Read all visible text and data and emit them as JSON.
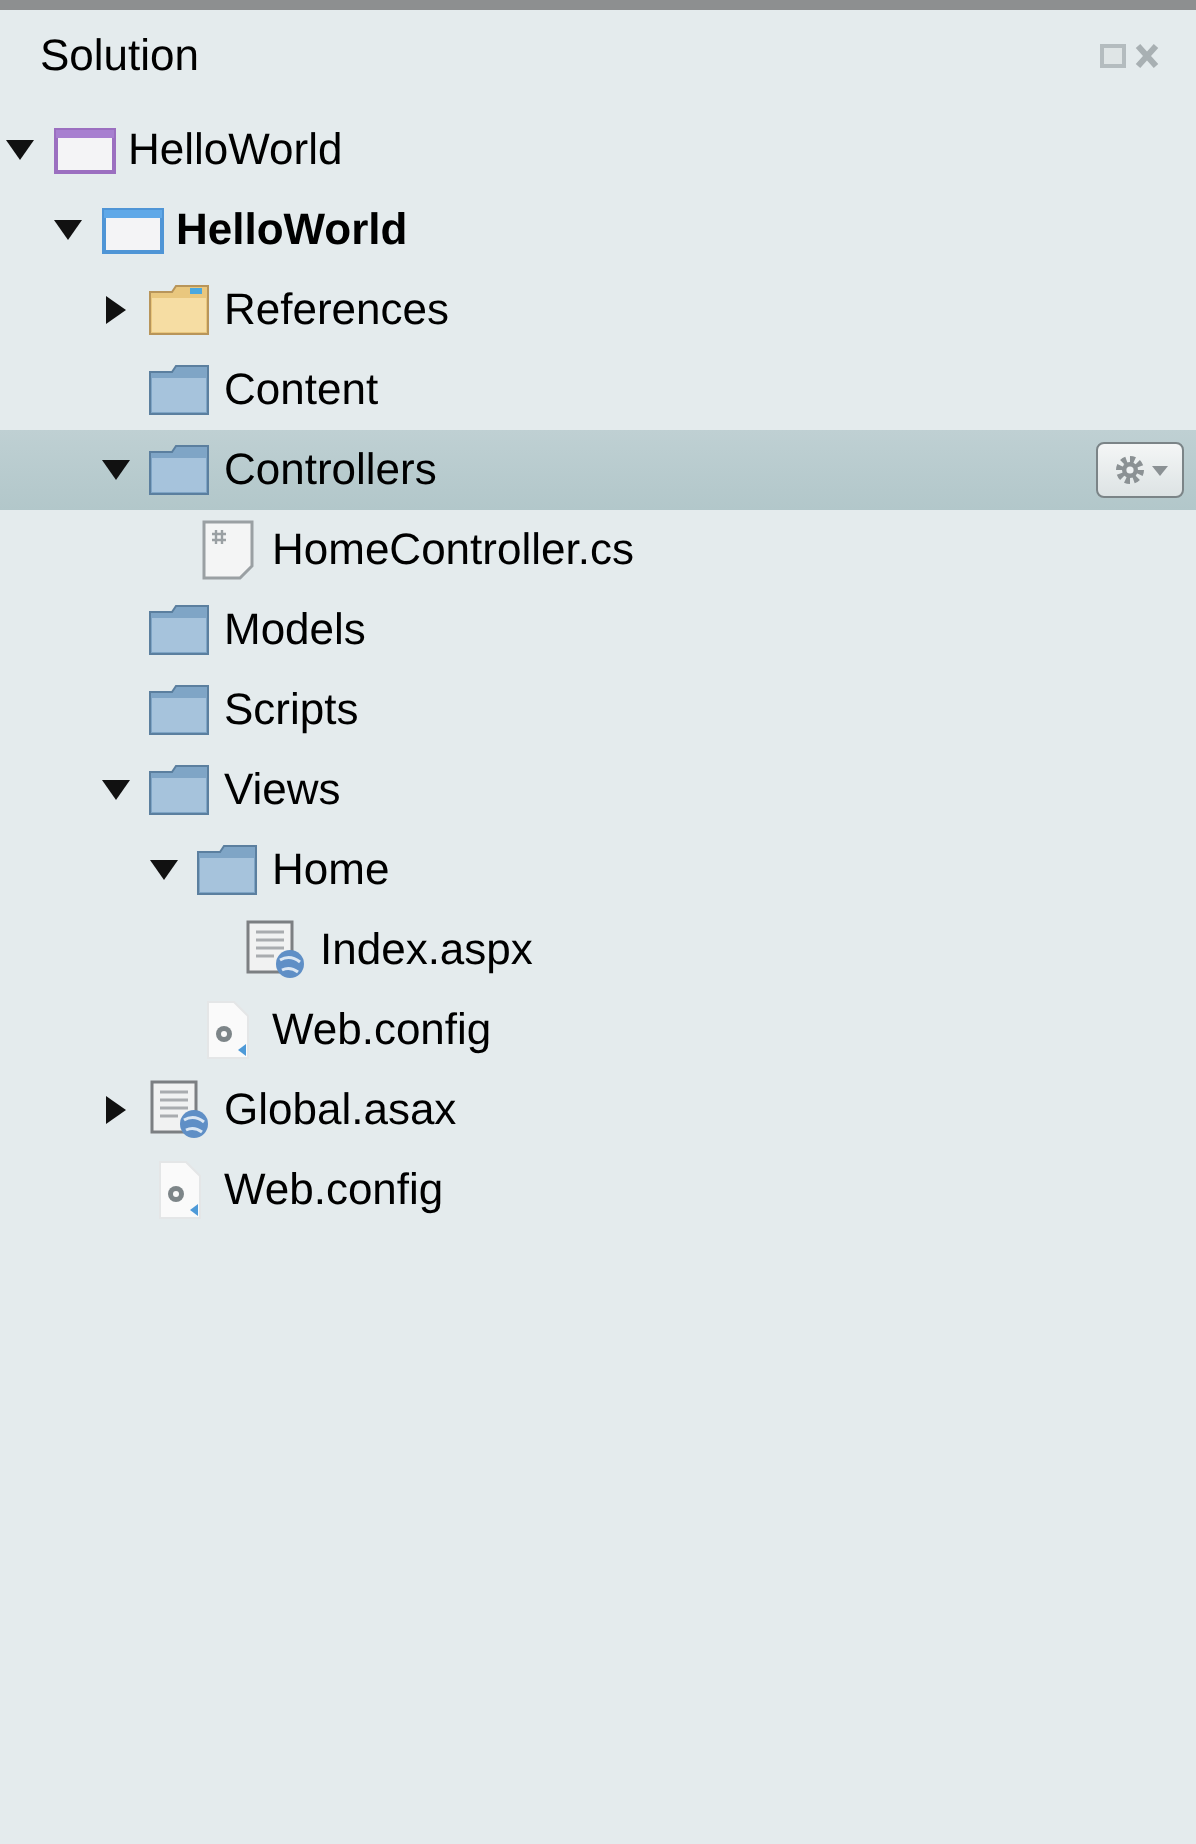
{
  "panel": {
    "title": "Solution"
  },
  "tree": [
    {
      "label": "HelloWorld",
      "kind": "solution",
      "expanded": true,
      "selected": false,
      "children": [
        {
          "label": "HelloWorld",
          "kind": "project",
          "startup": true,
          "expanded": true,
          "selected": false,
          "children": [
            {
              "label": "References",
              "kind": "references",
              "expanded": false,
              "selected": false
            },
            {
              "label": "Content",
              "kind": "folder",
              "selected": false
            },
            {
              "label": "Controllers",
              "kind": "folder",
              "expanded": true,
              "selected": true,
              "children": [
                {
                  "label": "HomeController.cs",
                  "kind": "cs",
                  "selected": false
                }
              ]
            },
            {
              "label": "Models",
              "kind": "folder",
              "selected": false
            },
            {
              "label": "Scripts",
              "kind": "folder",
              "selected": false
            },
            {
              "label": "Views",
              "kind": "folder",
              "expanded": true,
              "selected": false,
              "children": [
                {
                  "label": "Home",
                  "kind": "folder",
                  "expanded": true,
                  "selected": false,
                  "children": [
                    {
                      "label": "Index.aspx",
                      "kind": "page",
                      "selected": false
                    }
                  ]
                },
                {
                  "label": "Web.config",
                  "kind": "config",
                  "selected": false
                }
              ]
            },
            {
              "label": "Global.asax",
              "kind": "page",
              "expanded": false,
              "selected": false
            },
            {
              "label": "Web.config",
              "kind": "config",
              "selected": false
            }
          ]
        }
      ]
    }
  ]
}
